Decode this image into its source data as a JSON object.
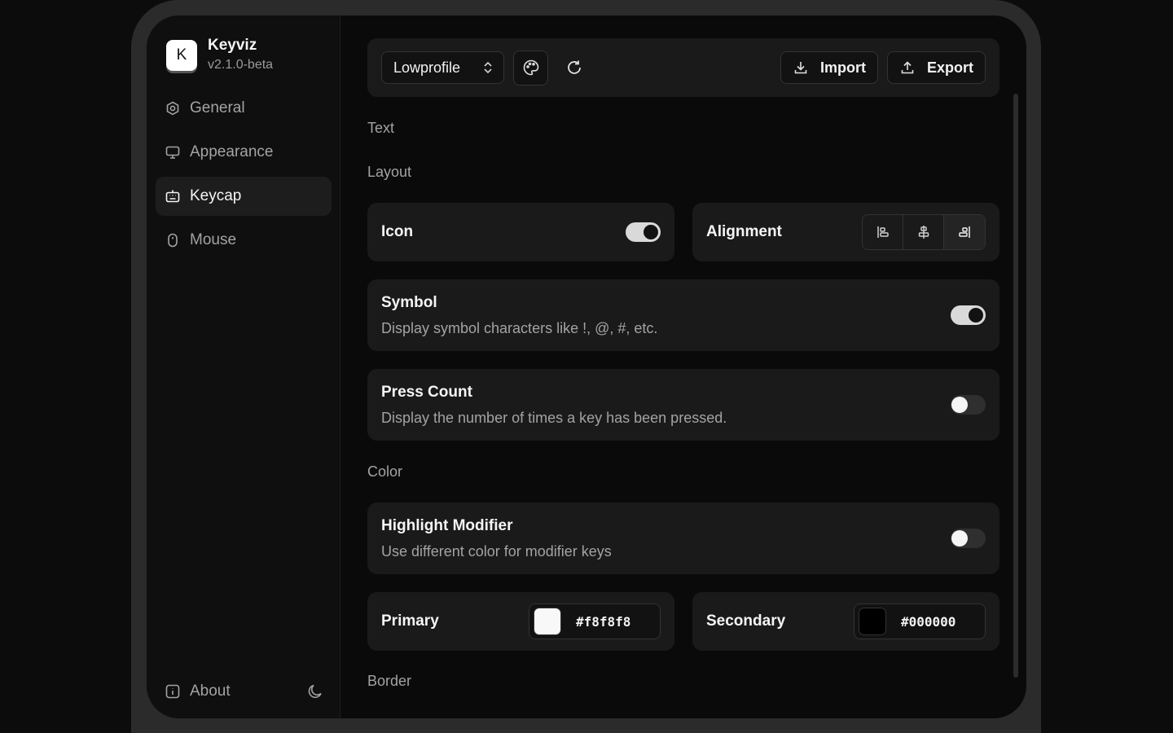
{
  "app": {
    "name": "Keyviz",
    "version": "v2.1.0-beta",
    "logo_letter": "K"
  },
  "sidebar": {
    "items": [
      {
        "label": "General",
        "icon": "gear-icon",
        "active": false
      },
      {
        "label": "Appearance",
        "icon": "monitor-icon",
        "active": false
      },
      {
        "label": "Keycap",
        "icon": "keycap-icon",
        "active": true
      },
      {
        "label": "Mouse",
        "icon": "mouse-icon",
        "active": false
      }
    ],
    "about_label": "About",
    "theme_icon": "moon-icon"
  },
  "toolbar": {
    "preset_value": "Lowprofile",
    "palette_icon": "palette-icon",
    "reset_icon": "refresh-icon",
    "import_label": "Import",
    "export_label": "Export"
  },
  "sections": {
    "text": "Text",
    "layout": "Layout",
    "color": "Color",
    "border": "Border"
  },
  "settings": {
    "icon": {
      "label": "Icon",
      "enabled": true
    },
    "alignment": {
      "label": "Alignment",
      "options": [
        "align-left",
        "align-center",
        "align-right"
      ],
      "selected": "align-right"
    },
    "symbol": {
      "label": "Symbol",
      "description": "Display symbol characters like !, @, #, etc.",
      "enabled": true
    },
    "press_count": {
      "label": "Press Count",
      "description": "Display the number of times a key has been pressed.",
      "enabled": false
    },
    "highlight_modifier": {
      "label": "Highlight Modifier",
      "description": "Use different color for modifier keys",
      "enabled": false
    },
    "primary": {
      "label": "Primary",
      "value": "#f8f8f8"
    },
    "secondary": {
      "label": "Secondary",
      "value": "#000000"
    }
  }
}
